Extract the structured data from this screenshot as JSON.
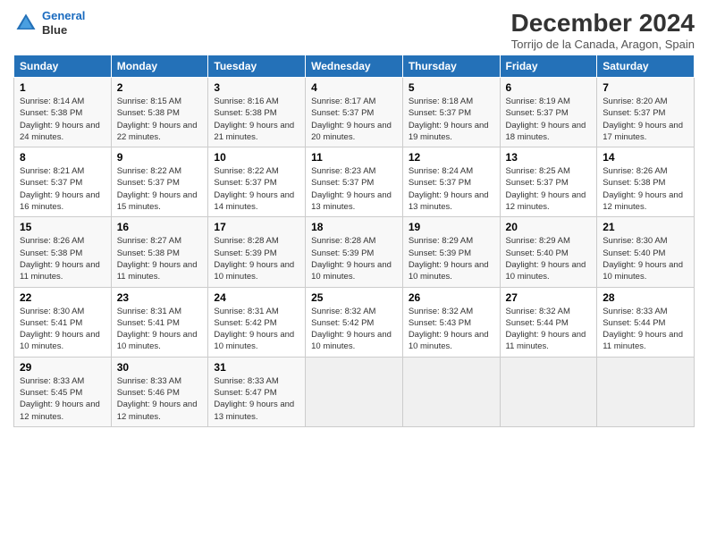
{
  "logo": {
    "line1": "General",
    "line2": "Blue"
  },
  "title": "December 2024",
  "location": "Torrijo de la Canada, Aragon, Spain",
  "days_of_week": [
    "Sunday",
    "Monday",
    "Tuesday",
    "Wednesday",
    "Thursday",
    "Friday",
    "Saturday"
  ],
  "weeks": [
    [
      {
        "day": "1",
        "sunrise": "8:14 AM",
        "sunset": "5:38 PM",
        "daylight": "9 hours and 24 minutes."
      },
      {
        "day": "2",
        "sunrise": "8:15 AM",
        "sunset": "5:38 PM",
        "daylight": "9 hours and 22 minutes."
      },
      {
        "day": "3",
        "sunrise": "8:16 AM",
        "sunset": "5:38 PM",
        "daylight": "9 hours and 21 minutes."
      },
      {
        "day": "4",
        "sunrise": "8:17 AM",
        "sunset": "5:37 PM",
        "daylight": "9 hours and 20 minutes."
      },
      {
        "day": "5",
        "sunrise": "8:18 AM",
        "sunset": "5:37 PM",
        "daylight": "9 hours and 19 minutes."
      },
      {
        "day": "6",
        "sunrise": "8:19 AM",
        "sunset": "5:37 PM",
        "daylight": "9 hours and 18 minutes."
      },
      {
        "day": "7",
        "sunrise": "8:20 AM",
        "sunset": "5:37 PM",
        "daylight": "9 hours and 17 minutes."
      }
    ],
    [
      {
        "day": "8",
        "sunrise": "8:21 AM",
        "sunset": "5:37 PM",
        "daylight": "9 hours and 16 minutes."
      },
      {
        "day": "9",
        "sunrise": "8:22 AM",
        "sunset": "5:37 PM",
        "daylight": "9 hours and 15 minutes."
      },
      {
        "day": "10",
        "sunrise": "8:22 AM",
        "sunset": "5:37 PM",
        "daylight": "9 hours and 14 minutes."
      },
      {
        "day": "11",
        "sunrise": "8:23 AM",
        "sunset": "5:37 PM",
        "daylight": "9 hours and 13 minutes."
      },
      {
        "day": "12",
        "sunrise": "8:24 AM",
        "sunset": "5:37 PM",
        "daylight": "9 hours and 13 minutes."
      },
      {
        "day": "13",
        "sunrise": "8:25 AM",
        "sunset": "5:37 PM",
        "daylight": "9 hours and 12 minutes."
      },
      {
        "day": "14",
        "sunrise": "8:26 AM",
        "sunset": "5:38 PM",
        "daylight": "9 hours and 12 minutes."
      }
    ],
    [
      {
        "day": "15",
        "sunrise": "8:26 AM",
        "sunset": "5:38 PM",
        "daylight": "9 hours and 11 minutes."
      },
      {
        "day": "16",
        "sunrise": "8:27 AM",
        "sunset": "5:38 PM",
        "daylight": "9 hours and 11 minutes."
      },
      {
        "day": "17",
        "sunrise": "8:28 AM",
        "sunset": "5:39 PM",
        "daylight": "9 hours and 10 minutes."
      },
      {
        "day": "18",
        "sunrise": "8:28 AM",
        "sunset": "5:39 PM",
        "daylight": "9 hours and 10 minutes."
      },
      {
        "day": "19",
        "sunrise": "8:29 AM",
        "sunset": "5:39 PM",
        "daylight": "9 hours and 10 minutes."
      },
      {
        "day": "20",
        "sunrise": "8:29 AM",
        "sunset": "5:40 PM",
        "daylight": "9 hours and 10 minutes."
      },
      {
        "day": "21",
        "sunrise": "8:30 AM",
        "sunset": "5:40 PM",
        "daylight": "9 hours and 10 minutes."
      }
    ],
    [
      {
        "day": "22",
        "sunrise": "8:30 AM",
        "sunset": "5:41 PM",
        "daylight": "9 hours and 10 minutes."
      },
      {
        "day": "23",
        "sunrise": "8:31 AM",
        "sunset": "5:41 PM",
        "daylight": "9 hours and 10 minutes."
      },
      {
        "day": "24",
        "sunrise": "8:31 AM",
        "sunset": "5:42 PM",
        "daylight": "9 hours and 10 minutes."
      },
      {
        "day": "25",
        "sunrise": "8:32 AM",
        "sunset": "5:42 PM",
        "daylight": "9 hours and 10 minutes."
      },
      {
        "day": "26",
        "sunrise": "8:32 AM",
        "sunset": "5:43 PM",
        "daylight": "9 hours and 10 minutes."
      },
      {
        "day": "27",
        "sunrise": "8:32 AM",
        "sunset": "5:44 PM",
        "daylight": "9 hours and 11 minutes."
      },
      {
        "day": "28",
        "sunrise": "8:33 AM",
        "sunset": "5:44 PM",
        "daylight": "9 hours and 11 minutes."
      }
    ],
    [
      {
        "day": "29",
        "sunrise": "8:33 AM",
        "sunset": "5:45 PM",
        "daylight": "9 hours and 12 minutes."
      },
      {
        "day": "30",
        "sunrise": "8:33 AM",
        "sunset": "5:46 PM",
        "daylight": "9 hours and 12 minutes."
      },
      {
        "day": "31",
        "sunrise": "8:33 AM",
        "sunset": "5:47 PM",
        "daylight": "9 hours and 13 minutes."
      },
      null,
      null,
      null,
      null
    ]
  ]
}
